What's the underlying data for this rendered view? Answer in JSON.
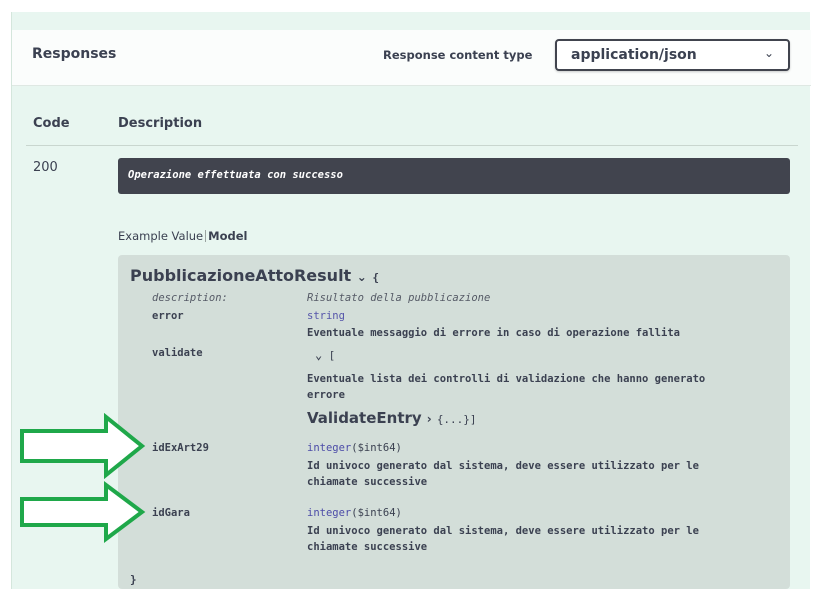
{
  "responses": {
    "title": "Responses",
    "content_type_label": "Response content type",
    "content_type_value": "application/json"
  },
  "table": {
    "code_header": "Code",
    "description_header": "Description",
    "row": {
      "code": "200",
      "description": "Operazione effettuata con successo"
    }
  },
  "example": {
    "tab_example": "Example Value",
    "tab_model": "Model"
  },
  "model": {
    "name": "PubblicazioneAttoResult",
    "open_brace": "{",
    "close_brace": "}",
    "description_key": "description:",
    "description_value": "Risultato della pubblicazione",
    "error_key": "error",
    "error_type": "string",
    "error_note": "Eventuale messaggio di errore in caso di operazione fallita",
    "validate_key": "validate",
    "validate_bracket": "[",
    "validate_note_line1": "Eventuale lista dei controlli di validazione che hanno generato",
    "validate_note_line2": "errore",
    "validate_entry_name": "ValidateEntry",
    "validate_entry_collapsed": "{...}]",
    "idexart_key": "idExArt29",
    "idexart_type_main": "integer",
    "idexart_type_fmt": "($int64)",
    "idexart_note_line1": "Id univoco generato dal sistema, deve essere utilizzato per le",
    "idexart_note_line2": "chiamate successive",
    "idgara_key": "idGara",
    "idgara_type_main": "integer",
    "idgara_type_fmt": "($int64)",
    "idgara_note_line1": "Id univoco generato dal sistema, deve essere utilizzato per le",
    "idgara_note_line2": "chiamate successive"
  },
  "colors": {
    "panel_bg": "#e8f6f0",
    "desc_bg": "#41444e",
    "model_bg": "#d3ded9",
    "arrow": "#1fa84a"
  },
  "icons": {
    "dropdown": "chevron-down-icon",
    "collapse": "chevron-down-icon",
    "expand": "chevron-right-icon",
    "annotation": "arrow-right-icon"
  }
}
